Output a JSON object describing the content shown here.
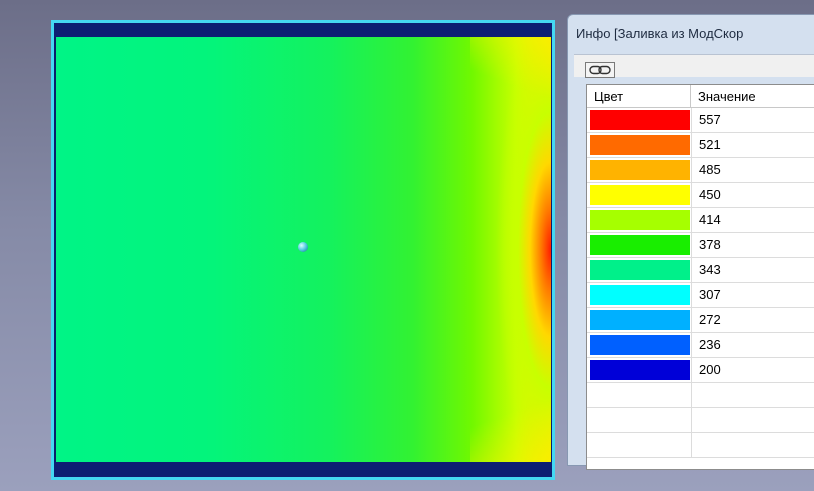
{
  "viewport": {
    "plate_colors": {
      "outline": "#45d8f2",
      "bands": "#0d1f73",
      "field": "#00f486",
      "hot_edge": "#ff1a00"
    }
  },
  "info_window": {
    "title": "Инфо [Заливка из МодСкор",
    "toolbar": {
      "link_icon": "link-icon"
    },
    "columns": [
      "Цвет",
      "Значение"
    ],
    "legend": [
      {
        "color": "#ff0000",
        "value": "557"
      },
      {
        "color": "#ff6a00",
        "value": "521"
      },
      {
        "color": "#ffb300",
        "value": "485"
      },
      {
        "color": "#ffff00",
        "value": "450"
      },
      {
        "color": "#a6ff00",
        "value": "414"
      },
      {
        "color": "#19ee00",
        "value": "378"
      },
      {
        "color": "#00f08a",
        "value": "343"
      },
      {
        "color": "#00ffff",
        "value": "307"
      },
      {
        "color": "#00b0ff",
        "value": "272"
      },
      {
        "color": "#0060ff",
        "value": "236"
      },
      {
        "color": "#0000d8",
        "value": "200"
      },
      {
        "color": "",
        "value": ""
      },
      {
        "color": "",
        "value": ""
      },
      {
        "color": "",
        "value": ""
      }
    ]
  }
}
